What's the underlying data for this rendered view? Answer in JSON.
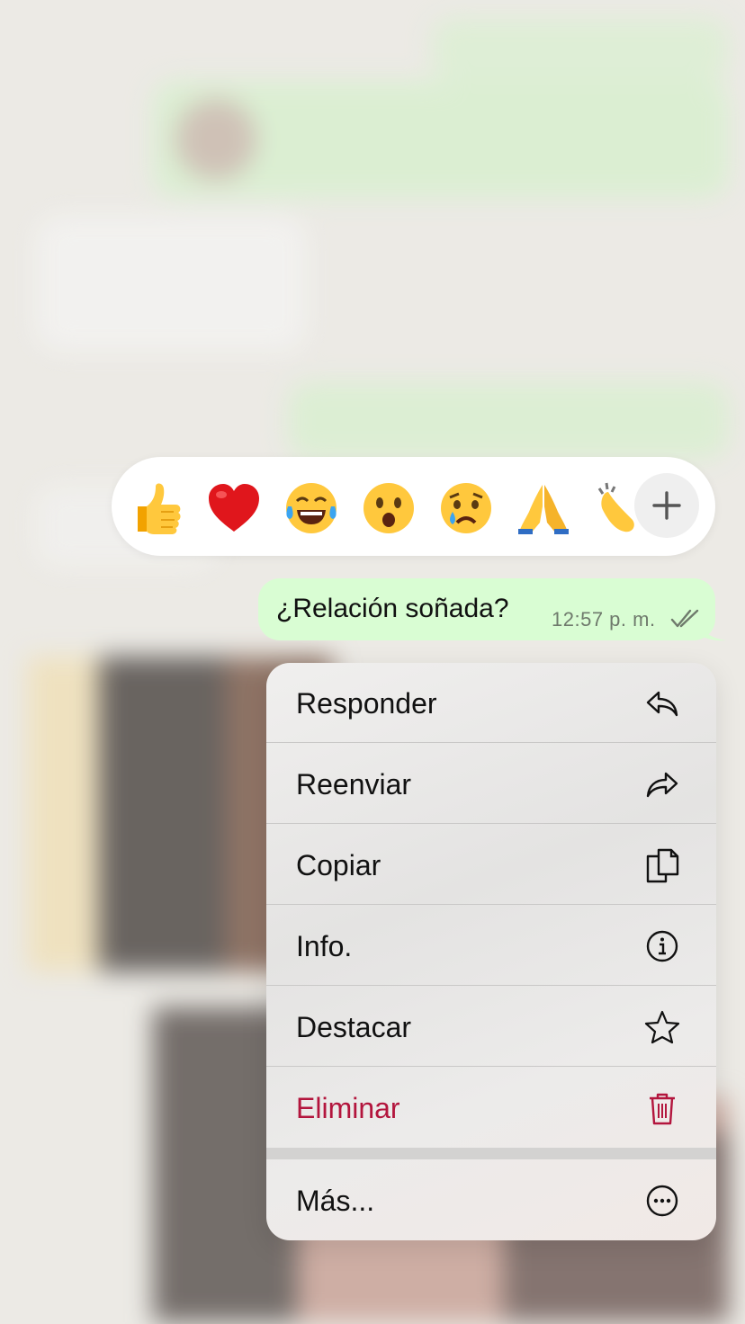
{
  "reactions": {
    "emojis": [
      {
        "name": "thumbs-up",
        "glyph": "👍"
      },
      {
        "name": "red-heart",
        "glyph": "❤️"
      },
      {
        "name": "face-with-tears-of-joy",
        "glyph": "😂"
      },
      {
        "name": "face-with-open-mouth",
        "glyph": "😮"
      },
      {
        "name": "crying-face",
        "glyph": "😢"
      },
      {
        "name": "folded-hands",
        "glyph": "🙏"
      },
      {
        "name": "clapping-hands",
        "glyph": "👏"
      }
    ],
    "more_label": "+"
  },
  "message": {
    "text": "¿Relación soñada?",
    "time": "12:57 p. m.",
    "status": "read",
    "bubble_color": "#d9fdd3"
  },
  "menu": {
    "items": [
      {
        "label": "Responder",
        "icon": "reply-icon"
      },
      {
        "label": "Reenviar",
        "icon": "forward-icon"
      },
      {
        "label": "Copiar",
        "icon": "copy-icon"
      },
      {
        "label": "Info.",
        "icon": "info-icon"
      },
      {
        "label": "Destacar",
        "icon": "star-icon"
      },
      {
        "label": "Eliminar",
        "icon": "trash-icon",
        "color": "#b3153d"
      },
      {
        "label": "Más...",
        "icon": "more-icon"
      }
    ]
  }
}
